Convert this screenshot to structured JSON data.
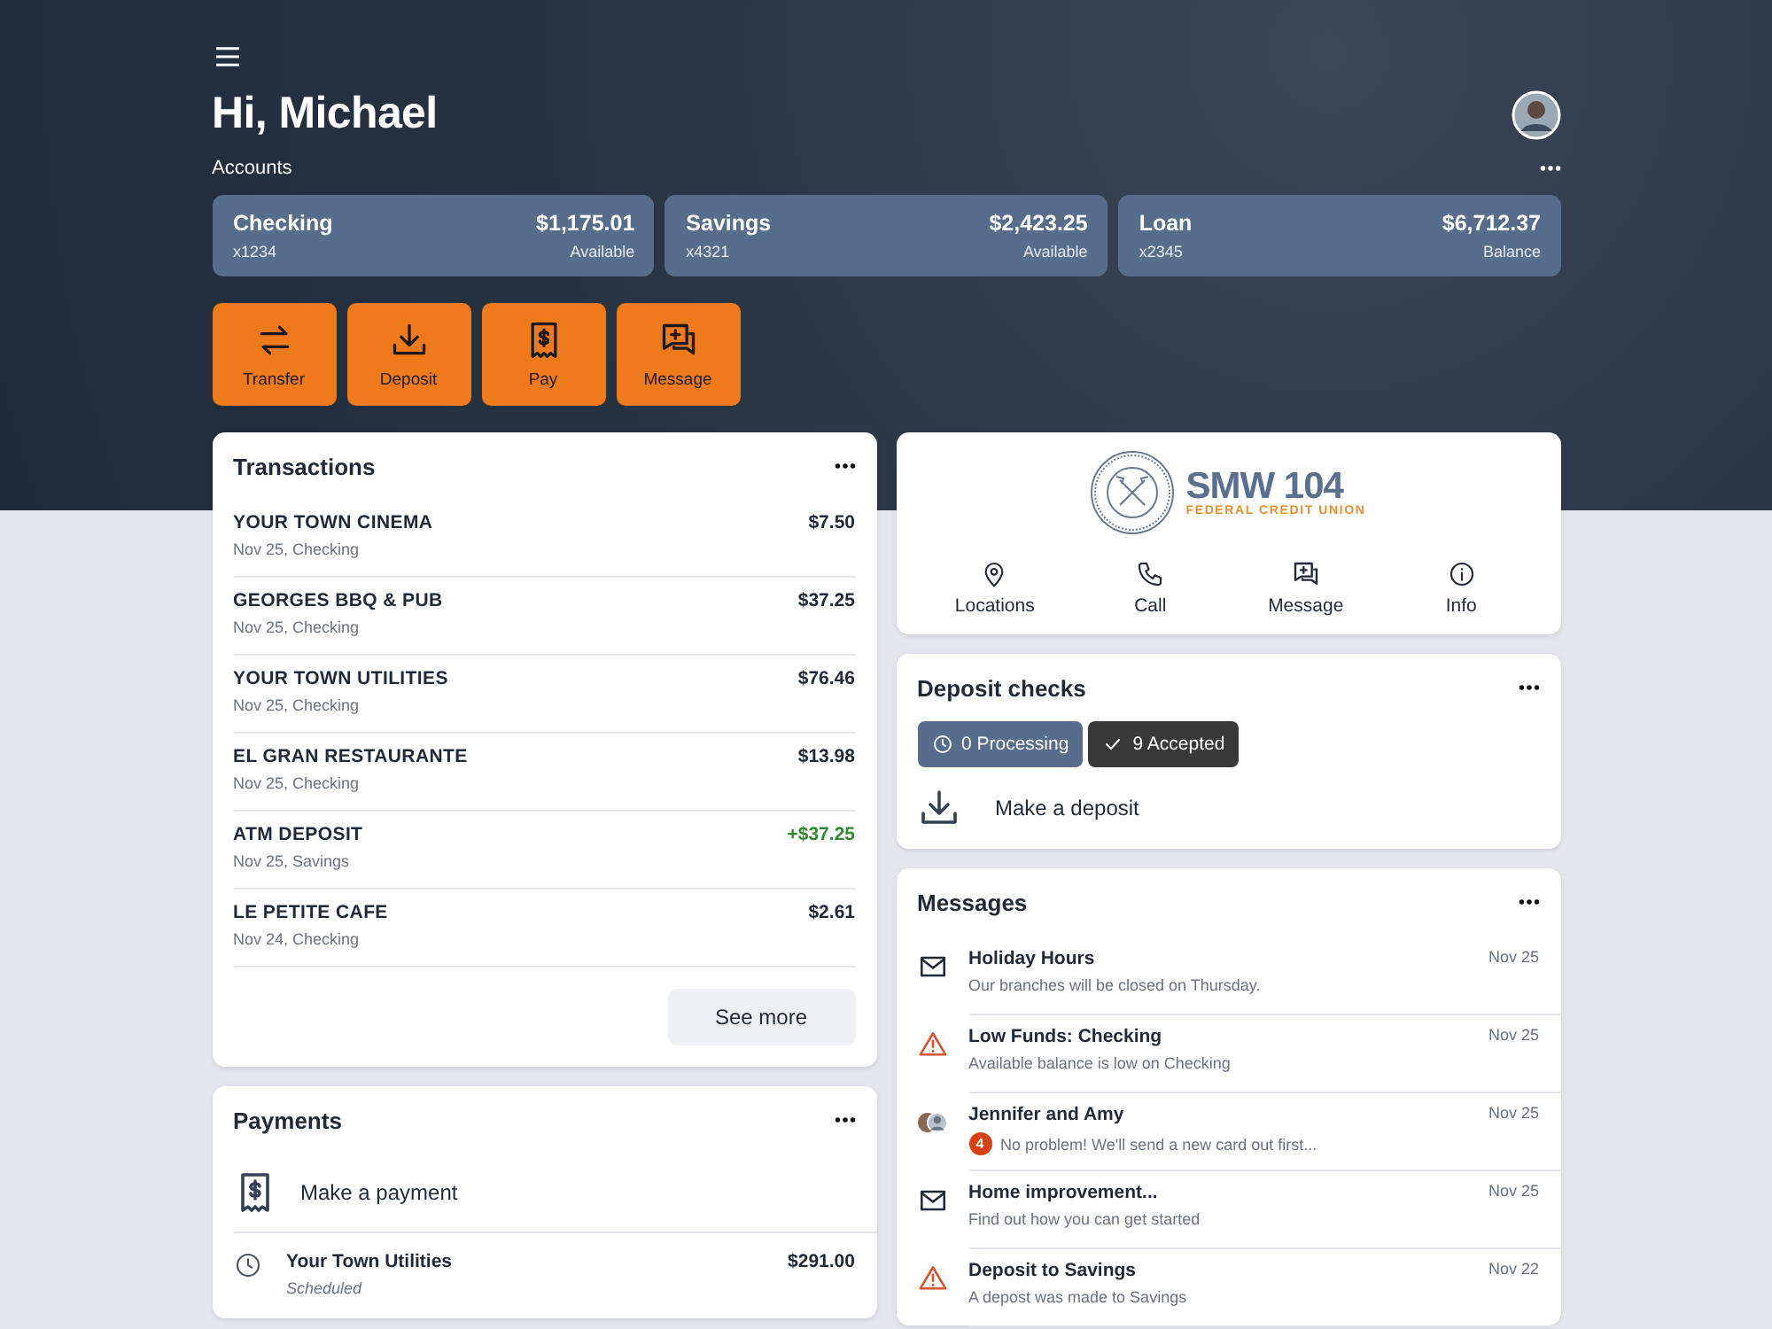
{
  "greeting": "Hi, Michael",
  "accounts_label": "Accounts",
  "accounts": [
    {
      "name": "Checking",
      "number": "x1234",
      "amount": "$1,175.01",
      "note": "Available"
    },
    {
      "name": "Savings",
      "number": "x4321",
      "amount": "$2,423.25",
      "note": "Available"
    },
    {
      "name": "Loan",
      "number": "x2345",
      "amount": "$6,712.37",
      "note": "Balance"
    }
  ],
  "actions": [
    {
      "kind": "transfer",
      "label": "Transfer"
    },
    {
      "kind": "deposit",
      "label": "Deposit"
    },
    {
      "kind": "pay",
      "label": "Pay"
    },
    {
      "kind": "message",
      "label": "Message"
    }
  ],
  "transactions": {
    "title": "Transactions",
    "rows": [
      {
        "name": "YOUR TOWN CINEMA",
        "detail": "Nov 25, Checking",
        "amount": "$7.50",
        "kind": "debit"
      },
      {
        "name": "GEORGES BBQ & PUB",
        "detail": "Nov 25, Checking",
        "amount": "$37.25",
        "kind": "debit"
      },
      {
        "name": "YOUR TOWN UTILITIES",
        "detail": "Nov 25, Checking",
        "amount": "$76.46",
        "kind": "debit"
      },
      {
        "name": "EL GRAN RESTAURANTE",
        "detail": "Nov 25, Checking",
        "amount": "$13.98",
        "kind": "debit"
      },
      {
        "name": "ATM DEPOSIT",
        "detail": "Nov 25, Savings",
        "amount": "+$37.25",
        "kind": "credit"
      },
      {
        "name": "LE PETITE CAFE",
        "detail": "Nov 24, Checking",
        "amount": "$2.61",
        "kind": "debit"
      }
    ],
    "button": "See more"
  },
  "payments": {
    "title": "Payments",
    "action": "Make a payment",
    "rows": [
      {
        "name": "Your Town Utilities",
        "status": "Scheduled",
        "amount": "$291.00"
      }
    ]
  },
  "credit_union": {
    "logo_name": "SMW 104",
    "logo_tagline": "FEDERAL CREDIT UNION",
    "links": [
      {
        "kind": "location",
        "label": "Locations"
      },
      {
        "kind": "call",
        "label": "Call"
      },
      {
        "kind": "message",
        "label": "Message"
      },
      {
        "kind": "info",
        "label": "Info"
      }
    ]
  },
  "deposit_checks": {
    "title": "Deposit checks",
    "chips": [
      {
        "kind": "processing",
        "label": "0 Processing"
      },
      {
        "kind": "accepted",
        "label": "9 Accepted"
      }
    ],
    "action": "Make a deposit"
  },
  "messages": {
    "title": "Messages",
    "items": [
      {
        "kind": "mail",
        "title": "Holiday Hours",
        "preview": "Our branches will be closed on Thursday.",
        "date": "Nov 25"
      },
      {
        "kind": "alert",
        "title": "Low Funds: Checking",
        "preview": "Available balance is low on Checking",
        "date": "Nov 25"
      },
      {
        "kind": "chat",
        "title": "Jennifer and Amy",
        "preview": "No problem! We'll send a new card out first...",
        "date": "Nov 25",
        "badge": "4"
      },
      {
        "kind": "mail",
        "title": "Home improvement...",
        "preview": "Find out how you can get started",
        "date": "Nov 25"
      },
      {
        "kind": "alert",
        "title": "Deposit to Savings",
        "preview": "A depost was made to Savings",
        "date": "Nov 22"
      }
    ]
  }
}
